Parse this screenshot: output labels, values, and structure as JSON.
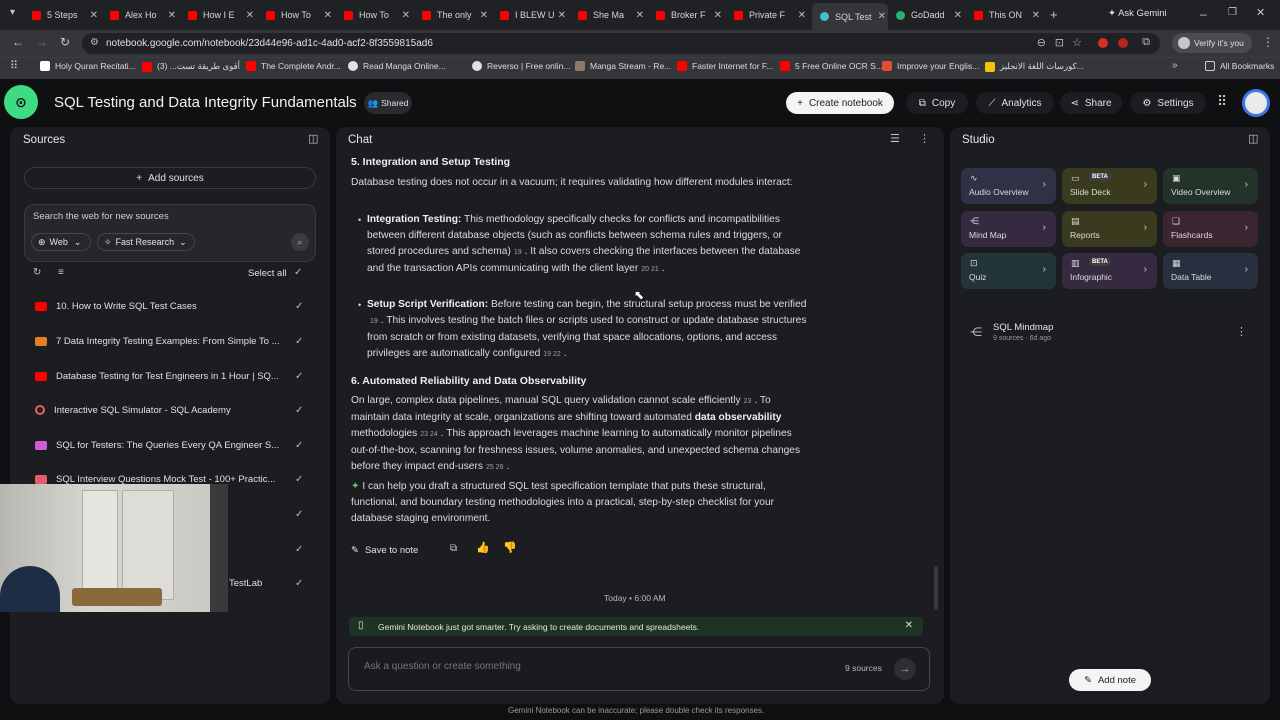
{
  "browser": {
    "tabs": [
      {
        "label": "5 Steps"
      },
      {
        "label": "Alex Ho"
      },
      {
        "label": "How I E"
      },
      {
        "label": "How To"
      },
      {
        "label": "How To"
      },
      {
        "label": "The only"
      },
      {
        "label": "I BLEW U"
      },
      {
        "label": "She Ma"
      },
      {
        "label": "Broker F"
      },
      {
        "label": "Private F"
      },
      {
        "label": "SQL Test"
      },
      {
        "label": "GoDadd"
      },
      {
        "label": "This ON"
      }
    ],
    "ask_gemini": "Ask Gemini",
    "url": "notebook.google.com/notebook/23d44e96-ad1c-4ad0-acf2-8f3559815ad6",
    "verify": "Verify it's you",
    "bookmarks": [
      {
        "label": "Holy Quran Recitati..."
      },
      {
        "label": "أقوى طريقة تست... (3)"
      },
      {
        "label": "The Complete Andr..."
      },
      {
        "label": "Read Manga Online..."
      },
      {
        "label": "Reverso | Free onlin..."
      },
      {
        "label": "Manga Stream - Re..."
      },
      {
        "label": "Faster Internet for F..."
      },
      {
        "label": "5 Free Online OCR S..."
      },
      {
        "label": "Improve your Englis..."
      },
      {
        "label": "كورسات اللغة الانجليز..."
      }
    ],
    "all_bookmarks": "All Bookmarks"
  },
  "app": {
    "title": "SQL Testing and Data Integrity Fundamentals",
    "shared": "Shared",
    "create_notebook": "Create notebook",
    "copy": "Copy",
    "analytics": "Analytics",
    "share": "Share",
    "settings": "Settings"
  },
  "sources": {
    "title": "Sources",
    "add_sources": "Add sources",
    "search_placeholder": "Search the web for new sources",
    "web": "Web",
    "fast_research": "Fast Research",
    "select_all": "Select all",
    "items": [
      {
        "label": "10. How to Write SQL Test Cases"
      },
      {
        "label": "7 Data Integrity Testing Examples: From Simple To ..."
      },
      {
        "label": "Database Testing for Test Engineers in 1 Hour | SQ..."
      },
      {
        "label": "Interactive SQL Simulator - SQL Academy"
      },
      {
        "label": "SQL for Testers: The Queries Every QA Engineer S..."
      },
      {
        "label": "SQL Interview Questions Mock Test - 100+ Practic..."
      },
      {
        "label": ""
      },
      {
        "label": ""
      },
      {
        "label": "TestLab"
      }
    ]
  },
  "chat": {
    "title": "Chat",
    "h5": "5. Integration and Setup Testing",
    "p1": "Database testing does not occur in a vacuum; it requires validating how different modules interact:",
    "b1_title": "Integration Testing:",
    "b1_text": "This methodology specifically checks for conflicts and incompatibilities between different database objects (such as conflicts between schema rules and triggers, or stored procedures and schema)",
    "b1_cite1": "19",
    "b1_text2": ". It also covers checking the interfaces between the database and the transaction APIs communicating with the client layer",
    "b1_cite2": "20 21",
    "b2_title": "Setup Script Verification:",
    "b2_text": "Before testing can begin, the structural setup process must be verified",
    "b2_cite1": "19",
    "b2_text2": ". This involves testing the batch files or scripts used to construct or update database structures from scratch or from existing datasets, verifying that space allocations, options, and access privileges are automatically configured",
    "b2_cite2": "19 22",
    "h6": "6. Automated Reliability and Data Observability",
    "p2a": "On large, complex data pipelines, manual SQL query validation cannot scale efficiently",
    "p2_cite1": "23",
    "p2b": ". To maintain data integrity at scale, organizations are shifting toward automated",
    "p2_bold": "data observability",
    "p2c": "methodologies",
    "p2_cite2": "23 24",
    "p2d": ". This approach leverages machine learning to automatically monitor pipelines out-of-the-box, scanning for freshness issues, volume anomalies, and unexpected schema changes before they impact end-users",
    "p2_cite3": "25 26",
    "p3": "I can help you draft a structured SQL test specification template that puts these structural, functional, and boundary testing methodologies into a practical, step-by-step checklist for your database staging environment.",
    "save_to_note": "Save to note",
    "timestamp": "Today • 6:00 AM",
    "banner": "Gemini Notebook just got smarter. Try asking to create documents and spreadsheets.",
    "input_placeholder": "Ask a question or create something",
    "source_count": "9 sources",
    "disclaimer": "Gemini Notebook can be inaccurate; please double check its responses."
  },
  "studio": {
    "title": "Studio",
    "cards": [
      {
        "label": "Audio Overview",
        "beta": ""
      },
      {
        "label": "Slide Deck",
        "beta": "BETA"
      },
      {
        "label": "Video Overview",
        "beta": ""
      },
      {
        "label": "Mind Map",
        "beta": ""
      },
      {
        "label": "Reports",
        "beta": ""
      },
      {
        "label": "Flashcards",
        "beta": ""
      },
      {
        "label": "Quiz",
        "beta": ""
      },
      {
        "label": "Infographic",
        "beta": "BETA"
      },
      {
        "label": "Data Table",
        "beta": ""
      }
    ],
    "mindmap_title": "SQL Mindmap",
    "mindmap_meta": "9 sources · 6d ago",
    "add_note": "Add note"
  },
  "colors": {
    "audio": "#2f3146",
    "slide": "#3a3a1e",
    "video": "#233329",
    "mind": "#352a3f",
    "reports": "#3a3a1e",
    "flash": "#3a2530",
    "quiz": "#24353a",
    "info": "#352a3f",
    "table": "#28303f"
  }
}
